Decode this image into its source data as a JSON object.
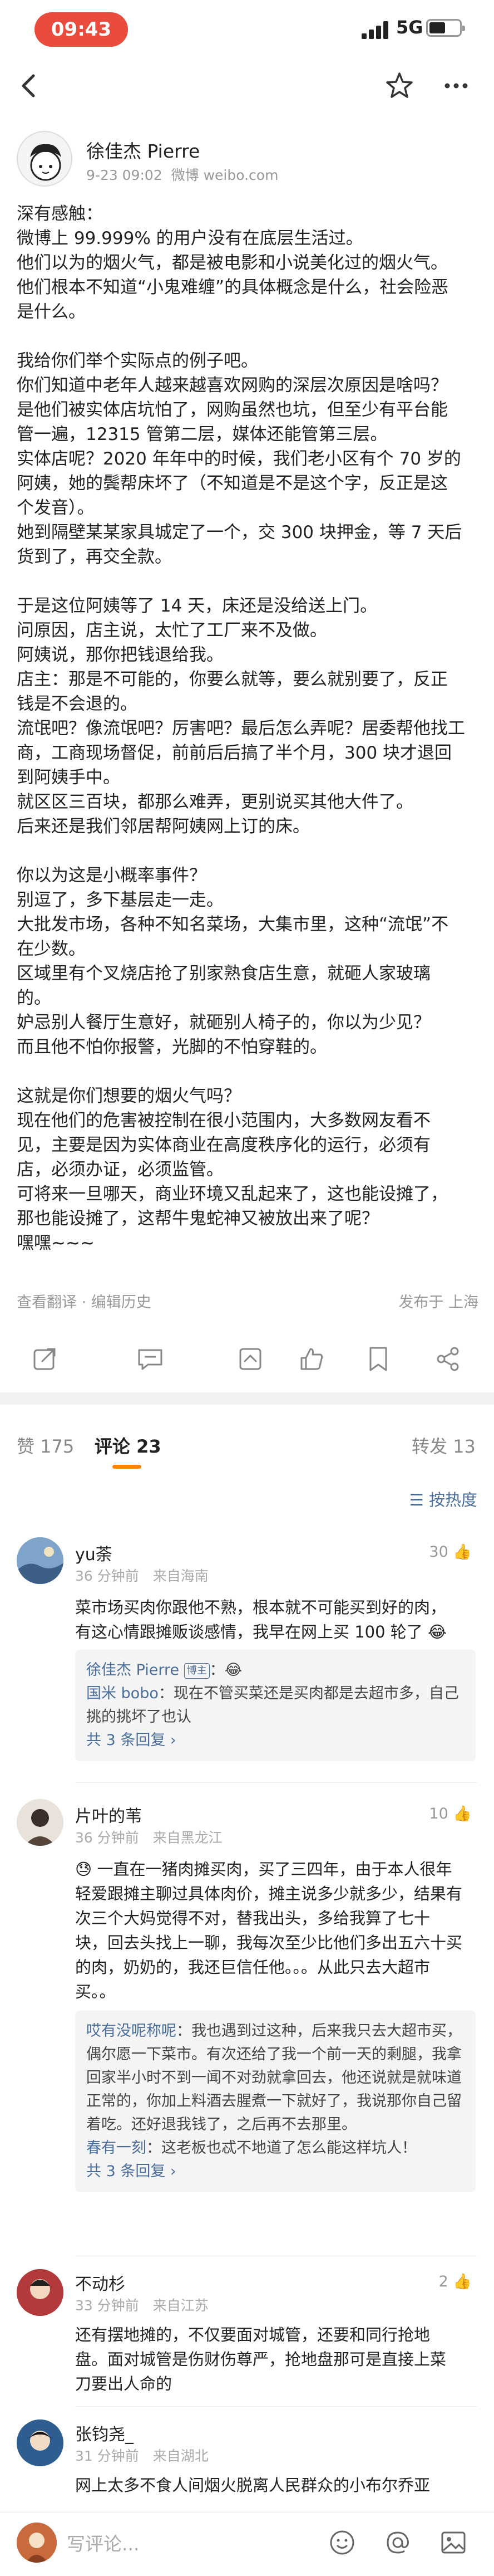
{
  "status_bar": {
    "time": "09:43",
    "network": "5G"
  },
  "post": {
    "author": "徐佳杰 Pierre",
    "date": "9-23 09:02",
    "source": "微博 weibo.com",
    "lines": [
      "深有感触：",
      "微博上 99.999% 的用户没有在底层生活过。",
      "他们以为的烟火气，都是被电影和小说美化过的烟火气。",
      "他们根本不知道“小鬼难缠”的具体概念是什么，社会险恶",
      "是什么。",
      "",
      "我给你们举个实际点的例子吧。",
      "你们知道中老年人越来越喜欢网购的深层次原因是啥吗？",
      "是他们被实体店坑怕了，网购虽然也坑，但至少有平台能",
      "管一遍，12315 管第二层，媒体还能管第三层。",
      "实体店呢？2020 年年中的时候，我们老小区有个 70 岁的",
      "阿姨，她的鬓帮床坏了（不知道是不是这个字，反正是这",
      "个发音）。",
      "她到隔壁某某家具城定了一个，交 300 块押金，等 7 天后",
      "货到了，再交全款。",
      "",
      "于是这位阿姨等了 14 天，床还是没给送上门。",
      "问原因，店主说，太忙了工厂来不及做。",
      "阿姨说，那你把钱退给我。",
      "店主：那是不可能的，你要么就等，要么就别要了，反正",
      "钱是不会退的。",
      "流氓吧？像流氓吧？厉害吧？最后怎么弄呢？居委帮他找工",
      "商，工商现场督促，前前后后搞了半个月，300 块才退回",
      "到阿姨手中。",
      "就区区三百块，都那么难弄，更别说买其他大件了。",
      "后来还是我们邻居帮阿姨网上订的床。",
      "",
      "你以为这是小概率事件？",
      "别逗了，多下基层走一走。",
      "大批发市场，各种不知名菜场，大集市里，这种“流氓”不",
      "在少数。",
      "区域里有个叉烧店抢了别家熟食店生意，就砸人家玻璃",
      "的。",
      "妒忌别人餐厅生意好，就砸别人椅子的，你以为少见？",
      "而且他不怕你报警，光脚的不怕穿鞋的。",
      "",
      "这就是你们想要的烟火气吗？",
      "现在他们的危害被控制在很小范围内，大多数网友看不",
      "见，主要是因为实体商业在高度秩序化的运行，必须有",
      "店，必须办证，必须监管。",
      "可将来一旦哪天，商业环境又乱起来了，这也能设摊了，",
      "那也能设摊了，这帮牛鬼蛇神又被放出来了呢？",
      "嘿嘿~~~"
    ],
    "footer_left": "查看翻译 · 编辑历史",
    "footer_right": "发布于 上海"
  },
  "tabs": [
    {
      "label": "赞 175"
    },
    {
      "label": "评论 23"
    },
    {
      "label": "转发 13"
    }
  ],
  "sort_label": "按热度",
  "comments": [
    {
      "name": "yu荼",
      "meta": "36 分钟前　来自海南",
      "likes": "30",
      "text": [
        "菜市场买肉你跟他不熟，根本就不可能买到好的肉，",
        "有这心情跟摊贩谈感情，我早在网上买 100 轮了 😂"
      ],
      "replies": [
        {
          "name": "徐佳杰 Pierre",
          "badge": "博主",
          "text": "：😂"
        },
        {
          "name": "国米 bobo",
          "text": "：现在不管买菜还是买肉都是去超市多，自己挑的挑坏了也认"
        }
      ],
      "more": "共 3 条回复 ›"
    },
    {
      "name": "片叶的苇",
      "meta": "36 分钟前　来自黑龙江",
      "likes": "10",
      "text": [
        "😓 一直在一猪肉摊买肉，买了三四年，由于本人很年",
        "轻爱跟摊主聊过具体肉价，摊主说多少就多少，结果有",
        "次三个大妈觉得不对，替我出头，多给我算了七十",
        "块，回去头找上一聊，我每次至少比他们多出五六十买",
        "的肉，奶奶的，我还巨信任他。。。从此只去大超市",
        "买。。"
      ],
      "replies": [
        {
          "name": "哎有没呢称呢",
          "text": "：我也遇到过这种，后来我只去大超市买，偶尔愿一下菜市。有次还给了我一个前一天的剩腿，我拿回家半小时不到一闻不对劲就拿回去，他还说就是就味道正常的，你加上料酒去腥煮一下就好了，我说那你自己留着吃。还好退我钱了，之后再不去那里。"
        },
        {
          "name": "春有一刻",
          "text": "：这老板也忒不地道了怎么能这样坑人！"
        }
      ],
      "more": "共 3 条回复 ›"
    },
    {
      "name": "不动杉",
      "meta": "33 分钟前　来自江苏",
      "likes": "2",
      "text": [
        "还有摆地摊的，不仅要面对城管，还要和同行抢地",
        "盘。面对城管是伤财伤尊严，抢地盘那可是直接上菜",
        "刀要出人命的"
      ]
    },
    {
      "name": "张钧尧_",
      "meta": "31 分钟前　来自湖北",
      "likes": "",
      "text": [
        "网上太多不食人间烟火脱离人民群众的小布尔乔亚"
      ]
    }
  ],
  "bottom_bar": {
    "placeholder": "写评论..."
  },
  "colors": {
    "accent": "#ff8200",
    "link": "#4a6e9c",
    "time_pill": "#e94b3c"
  },
  "icons": [
    "back-icon",
    "star-icon",
    "more-icon",
    "share-icon",
    "comment-icon",
    "like-icon",
    "repost-icon",
    "filter-icon",
    "emoji-icon",
    "at-icon",
    "image-icon"
  ]
}
